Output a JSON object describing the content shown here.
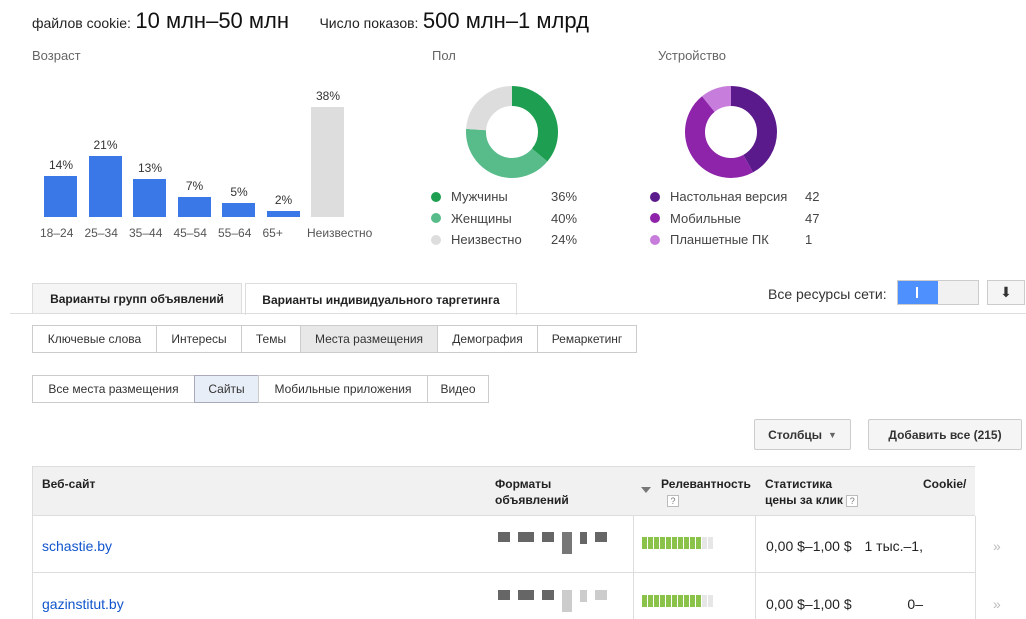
{
  "summary": {
    "cookies_label": "файлов cookie:",
    "cookies_value": "10 млн–50 млн",
    "impressions_label": "Число показов:",
    "impressions_value": "500 млн–1 млрд"
  },
  "age": {
    "title": "Возраст",
    "bars": [
      {
        "label": "18–24",
        "pct": "14%",
        "value": 14
      },
      {
        "label": "25–34",
        "pct": "21%",
        "value": 21
      },
      {
        "label": "35–44",
        "pct": "13%",
        "value": 13
      },
      {
        "label": "45–54",
        "pct": "7%",
        "value": 7
      },
      {
        "label": "55–64",
        "pct": "5%",
        "value": 5
      },
      {
        "label": "65+",
        "pct": "2%",
        "value": 2
      },
      {
        "label": "Неизвестно",
        "pct": "38%",
        "value": 38
      }
    ]
  },
  "gender": {
    "title": "Пол",
    "items": [
      {
        "label": "Мужчины",
        "pct": "36%",
        "value": 36,
        "color": "#1e9e50"
      },
      {
        "label": "Женщины",
        "pct": "40%",
        "value": 40,
        "color": "#57bb8a"
      },
      {
        "label": "Неизвестно",
        "pct": "24%",
        "value": 24,
        "color": "#dddddd"
      }
    ]
  },
  "device": {
    "title": "Устройство",
    "items": [
      {
        "label": "Настольная версия",
        "pct": "42",
        "value": 42,
        "color": "#5a1a8c"
      },
      {
        "label": "Мобильные",
        "pct": "47",
        "value": 47,
        "color": "#8e24aa"
      },
      {
        "label": "Планшетные ПК",
        "pct": "1",
        "value": 11,
        "color": "#c77ddb"
      }
    ]
  },
  "tabs": {
    "ad_groups": "Варианты групп объявлений",
    "targeting": "Варианты индивидуального таргетинга"
  },
  "network": {
    "label": "Все ресурсы сети:",
    "download_icon": "download-icon"
  },
  "subtabs": [
    "Ключевые слова",
    "Интересы",
    "Темы",
    "Места размещения",
    "Демография",
    "Ремаркетинг"
  ],
  "placement_filters": [
    "Все места размещения",
    "Сайты",
    "Мобильные приложения",
    "Видео"
  ],
  "buttons": {
    "columns": "Столбцы",
    "add_all": "Добавить все (215)"
  },
  "table": {
    "headers": {
      "site": "Веб-сайт",
      "formats_1": "Форматы",
      "formats_2": "объявлений",
      "relevance": "Релевантность",
      "cpc_1": "Статистика",
      "cpc_2": "цены за клик",
      "cookie": "Cookie/"
    },
    "rows": [
      {
        "site": "schastie.by",
        "relevance_segments": 10,
        "cpc": "0,00 $–1,00 $",
        "cookie": "1 тыс.–1,"
      },
      {
        "site": "gazinstitut.by",
        "relevance_segments": 10,
        "cpc": "0,00 $–1,00 $",
        "cookie": "0–"
      }
    ]
  }
}
